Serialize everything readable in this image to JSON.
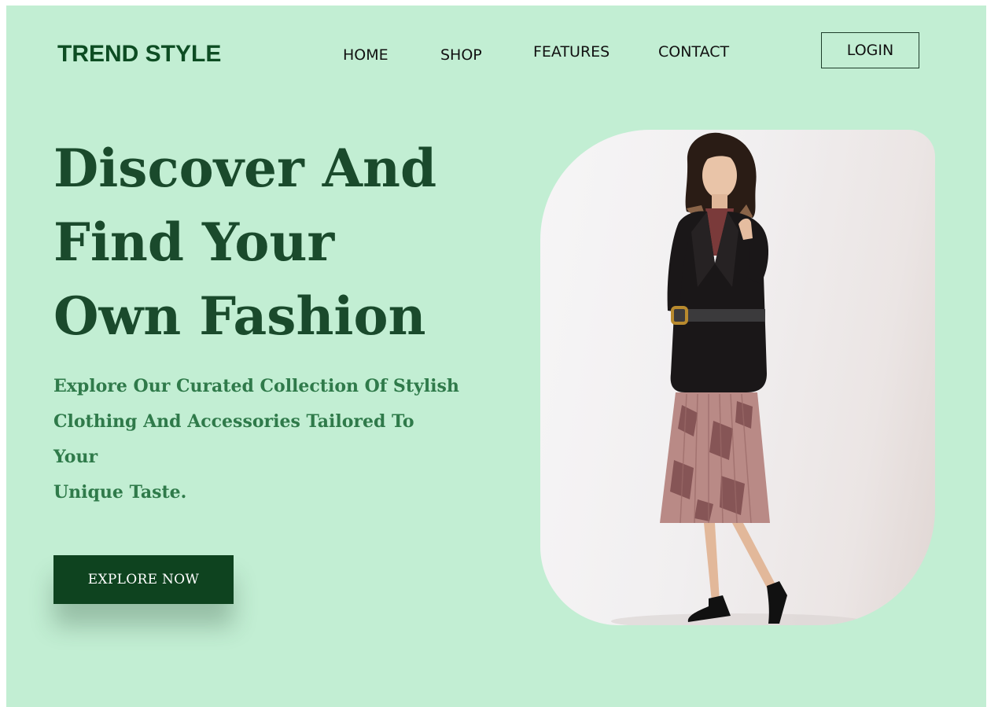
{
  "header": {
    "logo": "TREND STYLE",
    "nav": [
      "HOME",
      "SHOP",
      "FEATURES",
      "CONTACT"
    ],
    "login_label": "LOGIN"
  },
  "hero": {
    "title_lines": [
      "Discover And",
      "Find Your",
      "Own Fashion"
    ],
    "subtitle_lines": [
      "Explore Our Curated Collection Of Stylish",
      "Clothing And Accessories Tailored To Your",
      "Unique Taste."
    ],
    "cta_label": "EXPLORE NOW"
  },
  "colors": {
    "background": "#c2eed3",
    "brand": "#0d4d23",
    "heading": "#1a4a2c",
    "subtitle": "#2f7a4a",
    "button": "#0e431f"
  }
}
